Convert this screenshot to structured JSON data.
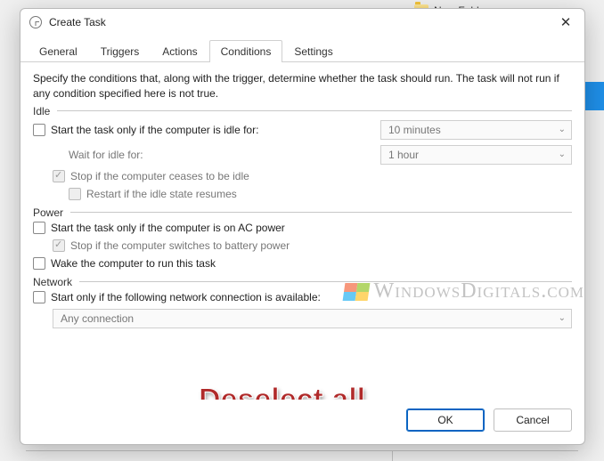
{
  "background": {
    "new_folder_label": "New Folder..."
  },
  "dialog": {
    "title": "Create Task",
    "tabs": [
      "General",
      "Triggers",
      "Actions",
      "Conditions",
      "Settings"
    ],
    "active_tab_index": 3,
    "description": "Specify the conditions that, along with the trigger, determine whether the task should run.  The task will not run  if any condition specified here is not true.",
    "idle": {
      "group": "Idle",
      "start_if_idle": "Start the task only if the computer is idle for:",
      "wait_for_idle": "Wait for idle for:",
      "stop_if_not_idle": "Stop if the computer ceases to be idle",
      "restart_if_idle": "Restart if the idle state resumes",
      "idle_duration": "10 minutes",
      "wait_duration": "1 hour"
    },
    "power": {
      "group": "Power",
      "start_on_ac": "Start the task only if the computer is on AC power",
      "stop_on_battery": "Stop if the computer switches to battery power",
      "wake_to_run": "Wake the computer to run this task"
    },
    "network": {
      "group": "Network",
      "start_if_network": "Start only if the following network connection is available:",
      "connection": "Any connection"
    },
    "buttons": {
      "ok": "OK",
      "cancel": "Cancel"
    }
  },
  "watermark": "WindowsDigitals.com",
  "annotation": "Deselect all"
}
